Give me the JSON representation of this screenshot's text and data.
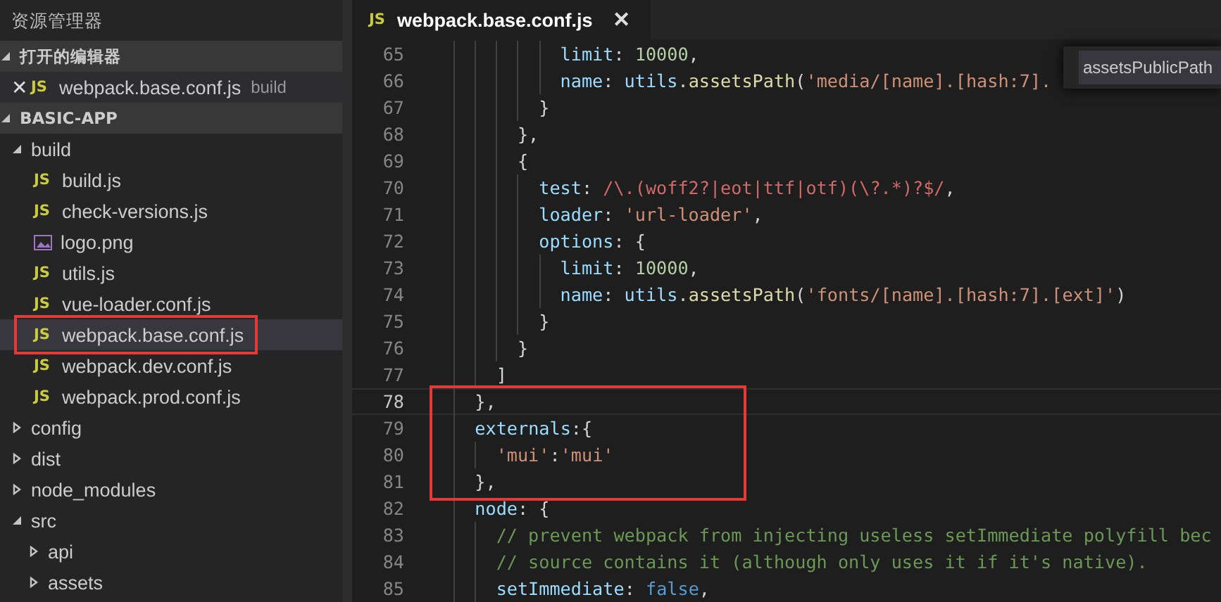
{
  "sidebar": {
    "title": "资源管理器",
    "open_editors": {
      "title": "打开的编辑器",
      "expanded": true,
      "items": [
        {
          "close": "✕",
          "badge": "JS",
          "name": "webpack.base.conf.js",
          "folder": "build",
          "kind": "js"
        }
      ]
    },
    "project": {
      "title": "BASIC-APP",
      "expanded": true,
      "tree": [
        {
          "name": "build",
          "kind": "folder",
          "expanded": true,
          "selected": false,
          "children": [
            {
              "name": "build.js",
              "kind": "js",
              "badge": "JS",
              "selected": false
            },
            {
              "name": "check-versions.js",
              "kind": "js",
              "badge": "JS",
              "selected": false
            },
            {
              "name": "logo.png",
              "kind": "image",
              "selected": false
            },
            {
              "name": "utils.js",
              "kind": "js",
              "badge": "JS",
              "selected": false
            },
            {
              "name": "vue-loader.conf.js",
              "kind": "js",
              "badge": "JS",
              "selected": false
            },
            {
              "name": "webpack.base.conf.js",
              "kind": "js",
              "badge": "JS",
              "selected": true,
              "boxed": true
            },
            {
              "name": "webpack.dev.conf.js",
              "kind": "js",
              "badge": "JS",
              "selected": false
            },
            {
              "name": "webpack.prod.conf.js",
              "kind": "js",
              "badge": "JS",
              "selected": false
            }
          ]
        },
        {
          "name": "config",
          "kind": "folder",
          "expanded": false,
          "selected": false
        },
        {
          "name": "dist",
          "kind": "folder",
          "expanded": false,
          "selected": false
        },
        {
          "name": "node_modules",
          "kind": "folder",
          "expanded": false,
          "selected": false
        },
        {
          "name": "src",
          "kind": "folder",
          "expanded": true,
          "selected": false,
          "children": [
            {
              "name": "api",
              "kind": "folder",
              "expanded": false,
              "selected": false
            },
            {
              "name": "assets",
              "kind": "folder",
              "expanded": false,
              "selected": false
            }
          ]
        }
      ]
    }
  },
  "tabs": [
    {
      "badge": "JS",
      "label": "webpack.base.conf.js",
      "close": "✕",
      "kind": "js",
      "selected": true
    }
  ],
  "suggestion": {
    "label": "assetsPublicPath"
  },
  "code": [
    {
      "number": "65",
      "current": false,
      "tokens": [
        {
          "text": "          limit",
          "kind": "key"
        },
        {
          "text": ": ",
          "kind": "punct"
        },
        {
          "text": "10000",
          "kind": "number"
        },
        {
          "text": ",",
          "kind": "punct"
        }
      ]
    },
    {
      "number": "66",
      "current": false,
      "tokens": [
        {
          "text": "          name",
          "kind": "key"
        },
        {
          "text": ": ",
          "kind": "punct"
        },
        {
          "text": "utils",
          "kind": "key"
        },
        {
          "text": ".",
          "kind": "punct"
        },
        {
          "text": "assetsPath",
          "kind": "func"
        },
        {
          "text": "(",
          "kind": "punct"
        },
        {
          "text": "'media/[name].[hash:7].",
          "kind": "string"
        }
      ]
    },
    {
      "number": "67",
      "current": false,
      "tokens": [
        {
          "text": "        }",
          "kind": "punct"
        }
      ]
    },
    {
      "number": "68",
      "current": false,
      "tokens": [
        {
          "text": "      },",
          "kind": "punct"
        }
      ]
    },
    {
      "number": "69",
      "current": false,
      "tokens": [
        {
          "text": "      {",
          "kind": "punct"
        }
      ]
    },
    {
      "number": "70",
      "current": false,
      "tokens": [
        {
          "text": "        test",
          "kind": "key"
        },
        {
          "text": ": ",
          "kind": "punct"
        },
        {
          "text": "/\\.(woff2?|eot|ttf|otf)(\\?.*)?$/",
          "kind": "regex"
        },
        {
          "text": ",",
          "kind": "punct"
        }
      ]
    },
    {
      "number": "71",
      "current": false,
      "tokens": [
        {
          "text": "        loader",
          "kind": "key"
        },
        {
          "text": ": ",
          "kind": "punct"
        },
        {
          "text": "'url-loader'",
          "kind": "string"
        },
        {
          "text": ",",
          "kind": "punct"
        }
      ]
    },
    {
      "number": "72",
      "current": false,
      "tokens": [
        {
          "text": "        options",
          "kind": "key"
        },
        {
          "text": ": {",
          "kind": "punct"
        }
      ]
    },
    {
      "number": "73",
      "current": false,
      "tokens": [
        {
          "text": "          limit",
          "kind": "key"
        },
        {
          "text": ": ",
          "kind": "punct"
        },
        {
          "text": "10000",
          "kind": "number"
        },
        {
          "text": ",",
          "kind": "punct"
        }
      ]
    },
    {
      "number": "74",
      "current": false,
      "tokens": [
        {
          "text": "          name",
          "kind": "key"
        },
        {
          "text": ": ",
          "kind": "punct"
        },
        {
          "text": "utils",
          "kind": "key"
        },
        {
          "text": ".",
          "kind": "punct"
        },
        {
          "text": "assetsPath",
          "kind": "func"
        },
        {
          "text": "(",
          "kind": "punct"
        },
        {
          "text": "'fonts/[name].[hash:7].[ext]'",
          "kind": "string"
        },
        {
          "text": ")",
          "kind": "punct"
        }
      ]
    },
    {
      "number": "75",
      "current": false,
      "tokens": [
        {
          "text": "        }",
          "kind": "punct"
        }
      ]
    },
    {
      "number": "76",
      "current": false,
      "tokens": [
        {
          "text": "      }",
          "kind": "punct"
        }
      ]
    },
    {
      "number": "77",
      "current": false,
      "tokens": [
        {
          "text": "    ]",
          "kind": "punct"
        }
      ]
    },
    {
      "number": "78",
      "current": true,
      "boxed": true,
      "tokens": [
        {
          "text": "  },",
          "kind": "punct"
        }
      ]
    },
    {
      "number": "79",
      "current": false,
      "boxed": true,
      "tokens": [
        {
          "text": "  externals",
          "kind": "key"
        },
        {
          "text": ":{",
          "kind": "punct"
        }
      ]
    },
    {
      "number": "80",
      "current": false,
      "boxed": true,
      "tokens": [
        {
          "text": "    'mui'",
          "kind": "string"
        },
        {
          "text": ":",
          "kind": "punct"
        },
        {
          "text": "'mui'",
          "kind": "string"
        }
      ]
    },
    {
      "number": "81",
      "current": false,
      "boxed": true,
      "tokens": [
        {
          "text": "  },",
          "kind": "punct"
        }
      ]
    },
    {
      "number": "82",
      "current": false,
      "tokens": [
        {
          "text": "  node",
          "kind": "key"
        },
        {
          "text": ": {",
          "kind": "punct"
        }
      ]
    },
    {
      "number": "83",
      "current": false,
      "tokens": [
        {
          "text": "    // prevent webpack from injecting useless setImmediate polyfill bec",
          "kind": "comment"
        }
      ]
    },
    {
      "number": "84",
      "current": false,
      "tokens": [
        {
          "text": "    // source contains it (although only uses it if it's native).",
          "kind": "comment"
        }
      ]
    },
    {
      "number": "85",
      "current": false,
      "tokens": [
        {
          "text": "    setImmediate",
          "kind": "key"
        },
        {
          "text": ": ",
          "kind": "punct"
        },
        {
          "text": "false",
          "kind": "keyword"
        },
        {
          "text": ",",
          "kind": "punct"
        }
      ]
    }
  ]
}
